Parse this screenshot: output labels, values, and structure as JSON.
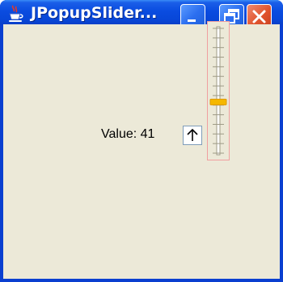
{
  "window": {
    "title": "JPopupSlider...",
    "controls": {
      "minimize": "minimize-icon",
      "maximize": "maximize-icon",
      "close": "close-icon"
    },
    "app_icon": "java-cup-icon"
  },
  "content": {
    "value_label": "Value: 41",
    "popup_button_icon": "arrow-up-icon"
  },
  "slider": {
    "orientation": "vertical",
    "value_fraction": 0.41,
    "thumb_color": "#f5b800",
    "border_color": "#f09f9f"
  },
  "colors": {
    "titlebar": "#0a4ce0",
    "client_bg": "#ece9d8",
    "close_button": "#e0542e"
  }
}
